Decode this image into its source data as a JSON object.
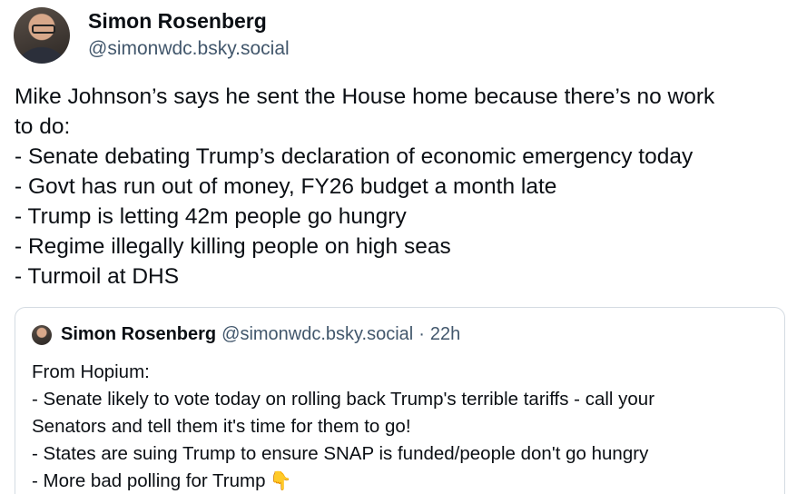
{
  "post": {
    "author": {
      "display_name": "Simon Rosenberg",
      "handle": "@simonwdc.bsky.social"
    },
    "text_lines": [
      "Mike Johnson’s says he sent the House home because there’s no work",
      "to do:",
      "- Senate debating Trump’s declaration of economic emergency today",
      "- Govt has run out of money, FY26 budget a month late",
      "- Trump is letting 42m people go hungry",
      "- Regime illegally killing people on high seas",
      "- Turmoil at DHS"
    ]
  },
  "quote": {
    "author": {
      "display_name": "Simon Rosenberg",
      "handle": "@simonwdc.bsky.social",
      "separator": "·",
      "time": "22h"
    },
    "text_lines": [
      "From Hopium:",
      "- Senate likely to vote today on rolling back Trump's terrible tariffs - call your",
      "Senators and tell them it's time for them to go!",
      "- States are suing Trump to ensure SNAP is funded/people don't go hungry",
      "- More bad polling for Trump"
    ],
    "last_line_emoji": "👇",
    "last_line_emoji_icon": "pointing-down-hand-icon"
  }
}
